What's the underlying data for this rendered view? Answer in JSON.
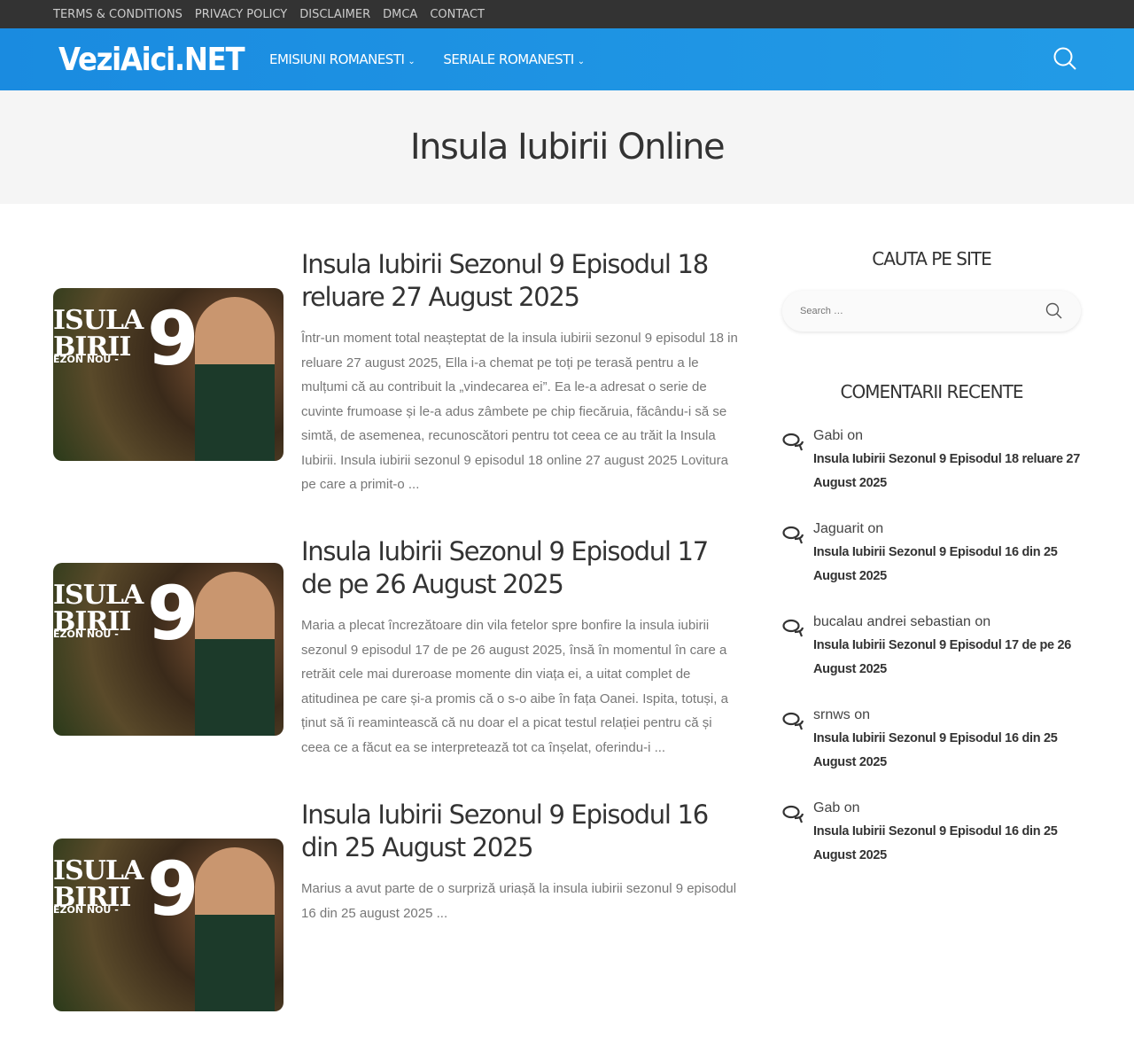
{
  "topbar": {
    "links": [
      "TERMS & CONDITIONS",
      "PRIVACY POLICY",
      "DISCLAIMER",
      "DMCA",
      "CONTACT"
    ]
  },
  "header": {
    "logo": "VeziAici.NET",
    "nav": [
      "EMISIUNI ROMANESTI",
      "SERIALE ROMANESTI"
    ],
    "chevron": "⌄",
    "search_icon": "search-icon"
  },
  "page_title": "Insula Iubirii Online",
  "thumbnail": {
    "line1": "ISULA",
    "line2": "BIRII",
    "line3": "EZON NOU -",
    "number": "9"
  },
  "posts": [
    {
      "title": "Insula Iubirii Sezonul 9 Episodul 18 reluare 27 August 2025",
      "excerpt": "Într-un moment total neașteptat de la insula iubirii sezonul 9 episodul 18 in reluare 27 august 2025, Ella i-a chemat pe toți pe terasă pentru a le mulțumi că au contribuit la „vindecarea ei”. Ea le-a adresat o serie de cuvinte frumoase și le-a adus zâmbete pe chip fiecăruia, făcându-i să se simtă, de asemenea, recunoscători pentru tot ceea ce au trăit la Insula Iubirii. Insula iubirii sezonul 9 episodul 18 online 27 august 2025 Lovitura pe care a primit-o ..."
    },
    {
      "title": "Insula Iubirii Sezonul 9 Episodul 17 de pe 26 August 2025",
      "excerpt": "Maria a plecat încrezătoare din vila fetelor spre bonfire la insula iubirii sezonul 9 episodul 17 de pe 26 august 2025, însă în momentul în care a retrăit cele mai dureroase momente din viața ei, a uitat complet de atitudinea pe care și-a promis că o s-o aibe în fața Oanei. Ispita, totuși, a ținut să îi reamintească că nu doar el a picat testul relației pentru că și ceea ce a făcut ea se interpretează tot ca înșelat, oferindu-i ..."
    },
    {
      "title": "Insula Iubirii Sezonul 9 Episodul 16 din 25 August 2025",
      "excerpt": "Marius a avut parte de o surpriză uriașă la insula iubirii sezonul 9 episodul 16 din 25 august 2025 ..."
    }
  ],
  "sidebar": {
    "search_title": "CAUTA PE SITE",
    "search_placeholder": "Search …",
    "comments_title": "COMENTARII RECENTE",
    "comments": [
      {
        "author": "Gabi on",
        "post": "Insula Iubirii Sezonul 9 Episodul 18 reluare 27 August 2025"
      },
      {
        "author": "Jaguarit on",
        "post": "Insula Iubirii Sezonul 9 Episodul 16 din 25 August 2025"
      },
      {
        "author": "bucalau andrei sebastian on",
        "post": "Insula Iubirii Sezonul 9 Episodul 17 de pe 26 August 2025"
      },
      {
        "author": "srnws on",
        "post": "Insula Iubirii Sezonul 9 Episodul 16 din 25 August 2025"
      },
      {
        "author": "Gab on",
        "post": "Insula Iubirii Sezonul 9 Episodul 16 din 25 August 2025"
      }
    ]
  }
}
